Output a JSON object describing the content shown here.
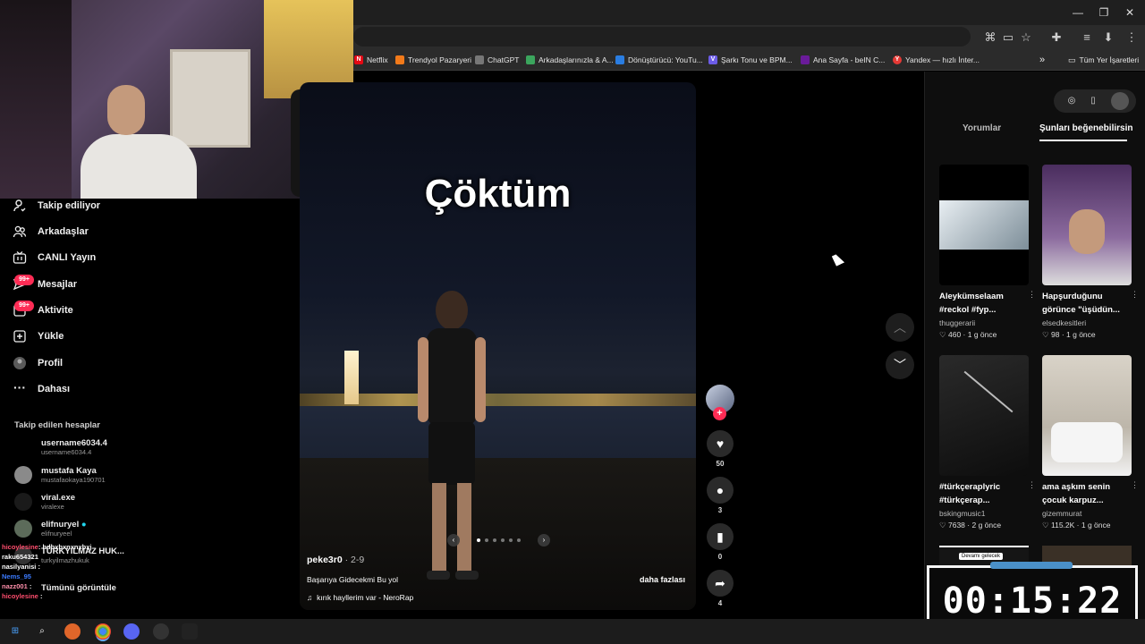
{
  "bookmarks": [
    {
      "label": "Netflix",
      "color": "#e50914"
    },
    {
      "label": "Trendyol Pazaryeri",
      "color": "#f27a1a"
    },
    {
      "label": "ChatGPT",
      "color": "#777777"
    },
    {
      "label": "Arkadaşlarınızla & A...",
      "color": "#3ba55d"
    },
    {
      "label": "Dönüştürücü: YouTu...",
      "color": "#2a7de1"
    },
    {
      "label": "Şarkı Tonu ve BPM...",
      "color": "#6c5ce7"
    },
    {
      "label": "Ana Sayfa - beIN C...",
      "color": "#6a1b9a"
    },
    {
      "label": "Yandex — hızlı İnter...",
      "color": "#e53935"
    }
  ],
  "bookmarks_more": "»",
  "bookmarks_all": "Tüm Yer İşaretleri",
  "window": {
    "minimize": "—",
    "restore": "❐",
    "close": "✕"
  },
  "sidebar": {
    "nav": [
      {
        "label": "Takip ediliyor",
        "icon": "person-follow-icon"
      },
      {
        "label": "Arkadaşlar",
        "icon": "friends-icon"
      },
      {
        "label": "CANLI Yayın",
        "icon": "live-icon"
      },
      {
        "label": "Mesajlar",
        "icon": "message-icon",
        "badge": "99+"
      },
      {
        "label": "Aktivite",
        "icon": "activity-icon",
        "badge": "99+"
      },
      {
        "label": "Yükle",
        "icon": "upload-icon"
      },
      {
        "label": "Profil",
        "icon": "profile-icon"
      },
      {
        "label": "Dahası",
        "icon": "more-icon"
      }
    ],
    "following_title": "Takip edilen hesaplar",
    "accounts": [
      {
        "name": "username6034.4",
        "user": "username6034.4"
      },
      {
        "name": "mustafa Kaya",
        "user": "mustafaokaya190701"
      },
      {
        "name": "viral.exe",
        "user": "viralexe"
      },
      {
        "name": "elifnuryel",
        "user": "elifnuryeel"
      },
      {
        "name": "TÜRKYILMAZ HUK...",
        "user": "turkyilmazhukuk"
      }
    ],
    "see_more": "Tümünü görüntüle"
  },
  "chat": [
    {
      "user": "hicoylesine",
      "msg": "hdbxbxnxnxbxj",
      "color": "#ff4d6d"
    },
    {
      "user": "raku654321",
      "msg": "",
      "color": "#ffffff"
    },
    {
      "user": "nasilyanisi",
      "msg": ":",
      "color": "#ffffff"
    },
    {
      "user": "Nems_95",
      "msg": "",
      "color": "#3b7bff"
    },
    {
      "user": "nazz001",
      "msg": ":",
      "color": "#ff8fab"
    },
    {
      "user": "hicoylesine",
      "msg": ":",
      "color": "#ff4d6d"
    }
  ],
  "video": {
    "overlay_text": "Çöktüm",
    "username": "peke3r0",
    "date": " · 2-9",
    "description": "Başarıya Gidecekmi Bu yol",
    "more": "daha fazlası",
    "music": "kırık hayllerim var - NeroRap"
  },
  "actions": {
    "likes": "50",
    "comments": "3",
    "saves": "0",
    "shares": "4"
  },
  "right_panel": {
    "tabs": [
      "Yorumlar",
      "Şunları beğenebilirsin"
    ],
    "cards": [
      {
        "title": "Aleykümselaam #reckol #fyp...",
        "user": "thuggerarii",
        "likes": "460",
        "time": "1 g önce",
        "color": "#c9d4dc"
      },
      {
        "title": "Hapşurduğunu görünce \"üşüdün...",
        "user": "elsedkesitleri",
        "likes": "98",
        "time": "1 g önce",
        "color": "#6a4a7a"
      },
      {
        "title": "#türkçeraplyric #türkçerap...",
        "user": "bskingmusic1",
        "likes": "7638",
        "time": "2 g önce",
        "color": "#1a1a1a"
      },
      {
        "title": "ama aşkım senin çocuk karpuz...",
        "user": "gizemmurat",
        "likes": "115.2K",
        "time": "1 g önce",
        "color": "#d9d3c8"
      }
    ],
    "next_label": "Devamı gelecek"
  },
  "timer": "00:15:22"
}
